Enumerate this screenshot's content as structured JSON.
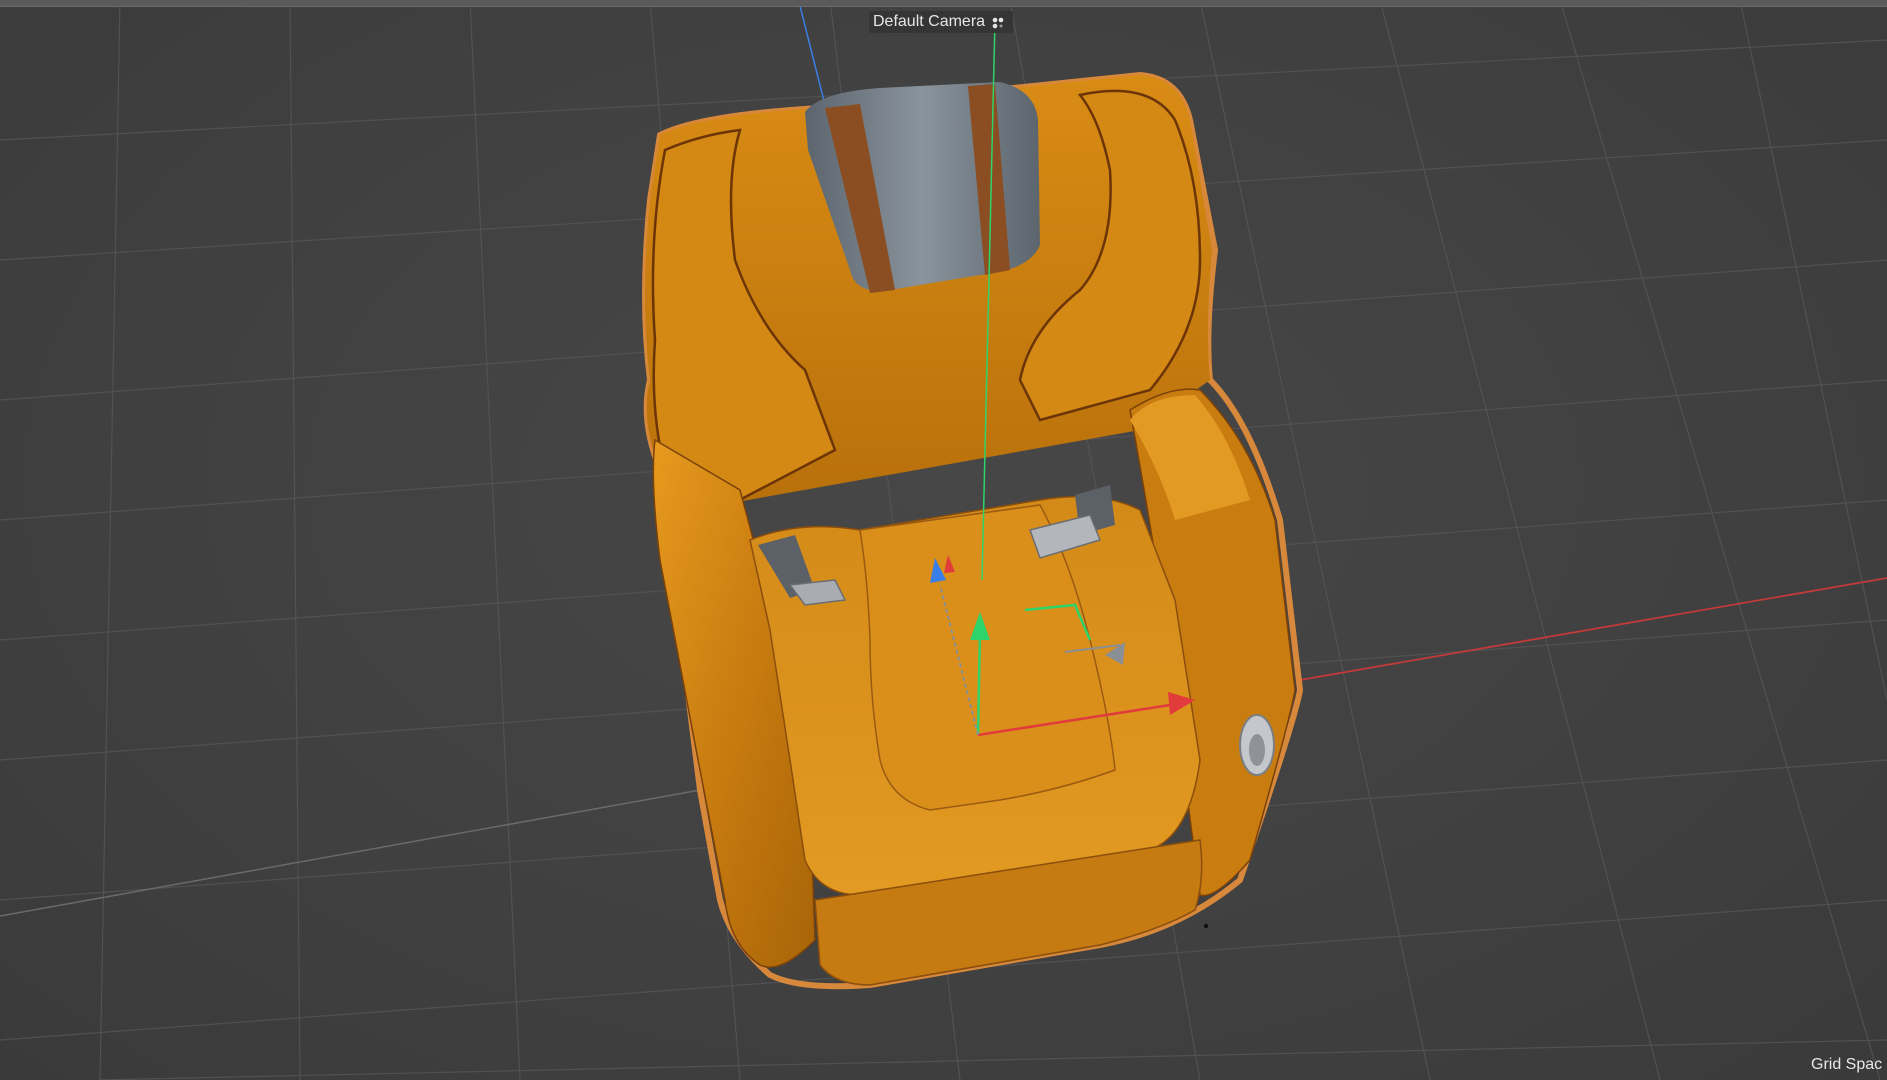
{
  "viewport": {
    "camera_name": "Default Camera",
    "camera_icon": "camera-settings-icon",
    "hud_grid_spacing": "Grid Spac"
  },
  "scene": {
    "object": "seat-model",
    "object_color": "#c97c10",
    "headrest_color": "#6e7882",
    "accent_color": "#8a4e22",
    "selection_outline_color": "#e8903a",
    "grid_color": "#555555",
    "background_color": "#404040",
    "axis_colors": {
      "x": "#e23b3b",
      "y": "#2ed36a",
      "z": "#3a7fe8"
    }
  }
}
